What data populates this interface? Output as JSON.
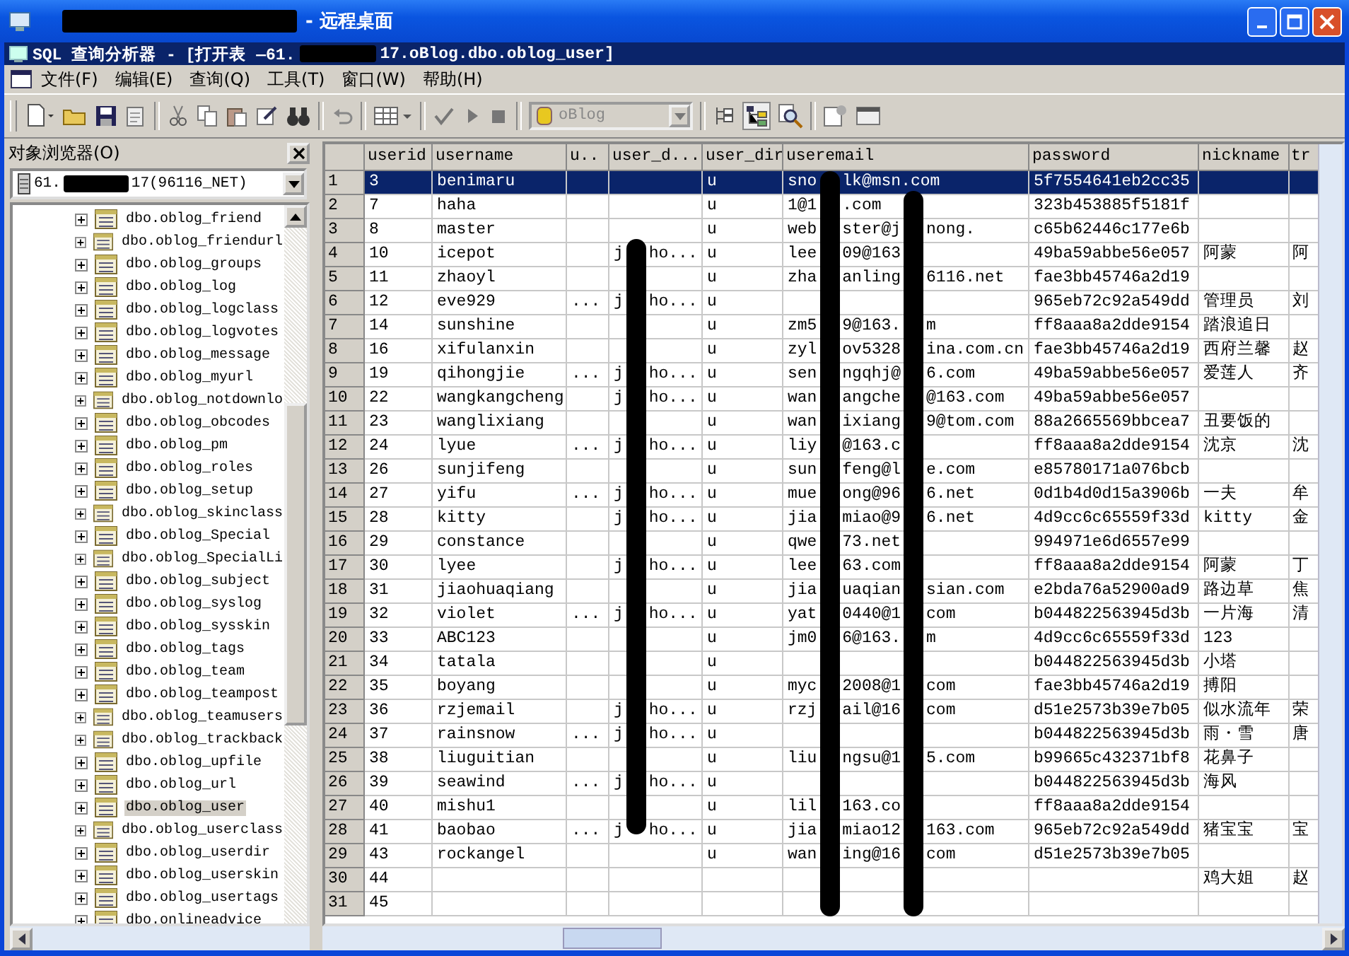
{
  "remote_window": {
    "title": "- 远程桌面"
  },
  "app_window": {
    "title_parts": [
      "SQL 查询分析器 - [打开表 —61.",
      "17.oBlog.dbo.oblog_user]"
    ]
  },
  "menu": [
    "文件(F)",
    "编辑(E)",
    "查询(Q)",
    "工具(T)",
    "窗口(W)",
    "帮助(H)"
  ],
  "toolbar": {
    "database": "oBlog"
  },
  "object_browser": {
    "title": "对象浏览器(O)",
    "server_parts": [
      "61.",
      "17(96116_NET)"
    ],
    "items": [
      {
        "label": "dbo.oblog_friend",
        "selected": false
      },
      {
        "label": "dbo.oblog_friendurl",
        "selected": false
      },
      {
        "label": "dbo.oblog_groups",
        "selected": false
      },
      {
        "label": "dbo.oblog_log",
        "selected": false
      },
      {
        "label": "dbo.oblog_logclass",
        "selected": false
      },
      {
        "label": "dbo.oblog_logvotes",
        "selected": false
      },
      {
        "label": "dbo.oblog_message",
        "selected": false
      },
      {
        "label": "dbo.oblog_myurl",
        "selected": false
      },
      {
        "label": "dbo.oblog_notdownlo",
        "selected": false
      },
      {
        "label": "dbo.oblog_obcodes",
        "selected": false
      },
      {
        "label": "dbo.oblog_pm",
        "selected": false
      },
      {
        "label": "dbo.oblog_roles",
        "selected": false
      },
      {
        "label": "dbo.oblog_setup",
        "selected": false
      },
      {
        "label": "dbo.oblog_skinclass",
        "selected": false
      },
      {
        "label": "dbo.oblog_Special",
        "selected": false
      },
      {
        "label": "dbo.oblog_SpecialLi",
        "selected": false
      },
      {
        "label": "dbo.oblog_subject",
        "selected": false
      },
      {
        "label": "dbo.oblog_syslog",
        "selected": false
      },
      {
        "label": "dbo.oblog_sysskin",
        "selected": false
      },
      {
        "label": "dbo.oblog_tags",
        "selected": false
      },
      {
        "label": "dbo.oblog_team",
        "selected": false
      },
      {
        "label": "dbo.oblog_teampost",
        "selected": false
      },
      {
        "label": "dbo.oblog_teamusers",
        "selected": false
      },
      {
        "label": "dbo.oblog_trackback",
        "selected": false
      },
      {
        "label": "dbo.oblog_upfile",
        "selected": false
      },
      {
        "label": "dbo.oblog_url",
        "selected": false
      },
      {
        "label": "dbo.oblog_user",
        "selected": true
      },
      {
        "label": "dbo.oblog_userclass",
        "selected": false
      },
      {
        "label": "dbo.oblog_userdir",
        "selected": false
      },
      {
        "label": "dbo.oblog_userskin",
        "selected": false
      },
      {
        "label": "dbo.oblog_usertags",
        "selected": false
      },
      {
        "label": "dbo.onlineadvice",
        "selected": false
      }
    ]
  },
  "grid": {
    "columns": [
      "userid",
      "username",
      "u..",
      "user_d...",
      "user_dir",
      "useremail",
      "password",
      "nickname",
      "tr"
    ],
    "rows": [
      {
        "row": "1",
        "selected": true,
        "userid": "3",
        "username": "benimaru",
        "user_dir": "u",
        "useremail": [
          "sno",
          "lk@msn.com"
        ],
        "password": "5f7554641eb2cc35"
      },
      {
        "row": "2",
        "selected": false,
        "userid": "7",
        "username": "haha",
        "user_dir": "u",
        "useremail": [
          "1@1",
          ".com"
        ],
        "password": "323b453885f5181f"
      },
      {
        "row": "3",
        "selected": false,
        "userid": "8",
        "username": "master",
        "user_dir": "u",
        "useremail": [
          "web",
          "ster@j",
          "nong."
        ],
        "password": "c65b62446c177e6b"
      },
      {
        "row": "4",
        "selected": false,
        "userid": "10",
        "username": "icepot",
        "column_4": [
          "j",
          "ho..."
        ],
        "user_dir": "u",
        "useremail": [
          "lee",
          "09@163"
        ],
        "password": "49ba59abbe56e057",
        "nickname": "阿蒙",
        "column_9": "阿"
      },
      {
        "row": "5",
        "selected": false,
        "userid": "11",
        "username": "zhaoyl",
        "user_dir": "u",
        "useremail": [
          "zha",
          "anling",
          "6116.net"
        ],
        "password": "fae3bb45746a2d19"
      },
      {
        "row": "6",
        "selected": false,
        "userid": "12",
        "username": "eve929",
        "column_3": "...",
        "column_4": [
          "j",
          "ho..."
        ],
        "user_dir": "u",
        "password": "965eb72c92a549dd",
        "nickname": "管理员",
        "column_9": "刘"
      },
      {
        "row": "7",
        "selected": false,
        "userid": "14",
        "username": "sunshine",
        "user_dir": "u",
        "useremail": [
          "zm5",
          "9@163.",
          "m"
        ],
        "password": "ff8aaa8a2dde9154",
        "nickname": "踏浪追日"
      },
      {
        "row": "8",
        "selected": false,
        "userid": "16",
        "username": "xifulanxin",
        "user_dir": "u",
        "useremail": [
          "zyl",
          "ov5328",
          "ina.com.cn"
        ],
        "password": "fae3bb45746a2d19",
        "nickname": "西府兰馨",
        "column_9": "赵"
      },
      {
        "row": "9",
        "selected": false,
        "userid": "19",
        "username": "qihongjie",
        "column_3": "...",
        "column_4": [
          "j",
          "ho..."
        ],
        "user_dir": "u",
        "useremail": [
          "sen",
          "ngqhj@",
          "6.com"
        ],
        "password": "49ba59abbe56e057",
        "nickname": "爱莲人",
        "column_9": "齐"
      },
      {
        "row": "10",
        "selected": false,
        "userid": "22",
        "username": "wangkangcheng",
        "column_4": [
          "j",
          "ho..."
        ],
        "user_dir": "u",
        "useremail": [
          "wan",
          "angche",
          "@163.com"
        ],
        "password": "49ba59abbe56e057"
      },
      {
        "row": "11",
        "selected": false,
        "userid": "23",
        "username": "wanglixiang",
        "user_dir": "u",
        "useremail": [
          "wan",
          "ixiang",
          "9@tom.com"
        ],
        "password": "88a2665569bbcea7",
        "nickname": "丑要饭的"
      },
      {
        "row": "12",
        "selected": false,
        "userid": "24",
        "username": "lyue",
        "column_3": "...",
        "column_4": [
          "j",
          "ho..."
        ],
        "user_dir": "u",
        "useremail": [
          "liy",
          "@163.c"
        ],
        "password": "ff8aaa8a2dde9154",
        "nickname": "沈京",
        "column_9": "沈"
      },
      {
        "row": "13",
        "selected": false,
        "userid": "26",
        "username": "sunjifeng",
        "user_dir": "u",
        "useremail": [
          "sun",
          "feng@l",
          "e.com"
        ],
        "password": "e85780171a076bcb"
      },
      {
        "row": "14",
        "selected": false,
        "userid": "27",
        "username": "yifu",
        "column_3": "...",
        "column_4": [
          "j",
          "ho..."
        ],
        "user_dir": "u",
        "useremail": [
          "mue",
          "ong@96",
          "6.net"
        ],
        "password": "0d1b4d0d15a3906b",
        "nickname": "一夫",
        "column_9": "牟"
      },
      {
        "row": "15",
        "selected": false,
        "userid": "28",
        "username": "kitty",
        "column_4": [
          "j",
          "ho..."
        ],
        "user_dir": "u",
        "useremail": [
          "jia",
          "miao@9",
          "6.net"
        ],
        "password": "4d9cc6c65559f33d",
        "nickname": "kitty",
        "column_9": "金"
      },
      {
        "row": "16",
        "selected": false,
        "userid": "29",
        "username": "constance",
        "user_dir": "u",
        "useremail": [
          "qwe",
          "73.net"
        ],
        "password": "994971e6d6557e99"
      },
      {
        "row": "17",
        "selected": false,
        "userid": "30",
        "username": "lyee",
        "column_4": [
          "j",
          "ho..."
        ],
        "user_dir": "u",
        "useremail": [
          "lee",
          "63.com"
        ],
        "password": "ff8aaa8a2dde9154",
        "nickname": "阿蒙",
        "column_9": "丁"
      },
      {
        "row": "18",
        "selected": false,
        "userid": "31",
        "username": "jiaohuaqiang",
        "user_dir": "u",
        "useremail": [
          "jia",
          "uaqian",
          "sian.com"
        ],
        "password": "e2bda76a52900ad9",
        "nickname": "路边草",
        "column_9": "焦"
      },
      {
        "row": "19",
        "selected": false,
        "userid": "32",
        "username": "violet",
        "column_3": "...",
        "column_4": [
          "j",
          "ho..."
        ],
        "user_dir": "u",
        "useremail": [
          "yat",
          "0440@1",
          "com"
        ],
        "password": "b044822563945d3b",
        "nickname": "一片海",
        "column_9": "清"
      },
      {
        "row": "20",
        "selected": false,
        "userid": "33",
        "username": "ABC123",
        "user_dir": "u",
        "useremail": [
          "jm0",
          "6@163.",
          "m"
        ],
        "password": "4d9cc6c65559f33d",
        "nickname": "123"
      },
      {
        "row": "21",
        "selected": false,
        "userid": "34",
        "username": "tatala",
        "user_dir": "u",
        "password": "b044822563945d3b",
        "nickname": "小塔"
      },
      {
        "row": "22",
        "selected": false,
        "userid": "35",
        "username": "boyang",
        "user_dir": "u",
        "useremail": [
          "myc",
          "2008@1",
          "com"
        ],
        "password": "fae3bb45746a2d19",
        "nickname": "搏阳"
      },
      {
        "row": "23",
        "selected": false,
        "userid": "36",
        "username": "rzjemail",
        "column_4": [
          "j",
          "ho..."
        ],
        "user_dir": "u",
        "useremail": [
          "rzj",
          "ail@16",
          "com"
        ],
        "password": "d51e2573b39e7b05",
        "nickname": "似水流年",
        "column_9": "荣"
      },
      {
        "row": "24",
        "selected": false,
        "userid": "37",
        "username": "rainsnow",
        "column_3": "...",
        "column_4": [
          "j",
          "ho..."
        ],
        "user_dir": "u",
        "password": "b044822563945d3b",
        "nickname": "雨・雪",
        "column_9": "唐"
      },
      {
        "row": "25",
        "selected": false,
        "userid": "38",
        "username": "liuguitian",
        "user_dir": "u",
        "useremail": [
          "liu",
          "ngsu@1",
          "5.com"
        ],
        "password": "b99665c432371bf8",
        "nickname": "花鼻子"
      },
      {
        "row": "26",
        "selected": false,
        "userid": "39",
        "username": "seawind",
        "column_3": "...",
        "column_4": [
          "j",
          "ho..."
        ],
        "user_dir": "u",
        "password": "b044822563945d3b",
        "nickname": "海风"
      },
      {
        "row": "27",
        "selected": false,
        "userid": "40",
        "username": "mishu1",
        "user_dir": "u",
        "useremail": [
          "lil",
          "163.co"
        ],
        "password": "ff8aaa8a2dde9154"
      },
      {
        "row": "28",
        "selected": false,
        "userid": "41",
        "username": "baobao",
        "column_3": "...",
        "column_4": [
          "j",
          "ho..."
        ],
        "user_dir": "u",
        "useremail": [
          "jia",
          "miao12",
          "163.com"
        ],
        "password": "965eb72c92a549dd",
        "nickname": "猪宝宝",
        "column_9": "宝"
      },
      {
        "row": "29",
        "selected": false,
        "userid": "43",
        "username": "rockangel",
        "user_dir": "u",
        "useremail": [
          "wan",
          "ing@16",
          "com"
        ],
        "password": "d51e2573b39e7b05"
      },
      {
        "row": "30",
        "selected": false,
        "userid": "44",
        "nickname": "鸡大姐",
        "column_9": "赵"
      },
      {
        "row": "31",
        "selected": false,
        "userid": "45"
      }
    ]
  }
}
